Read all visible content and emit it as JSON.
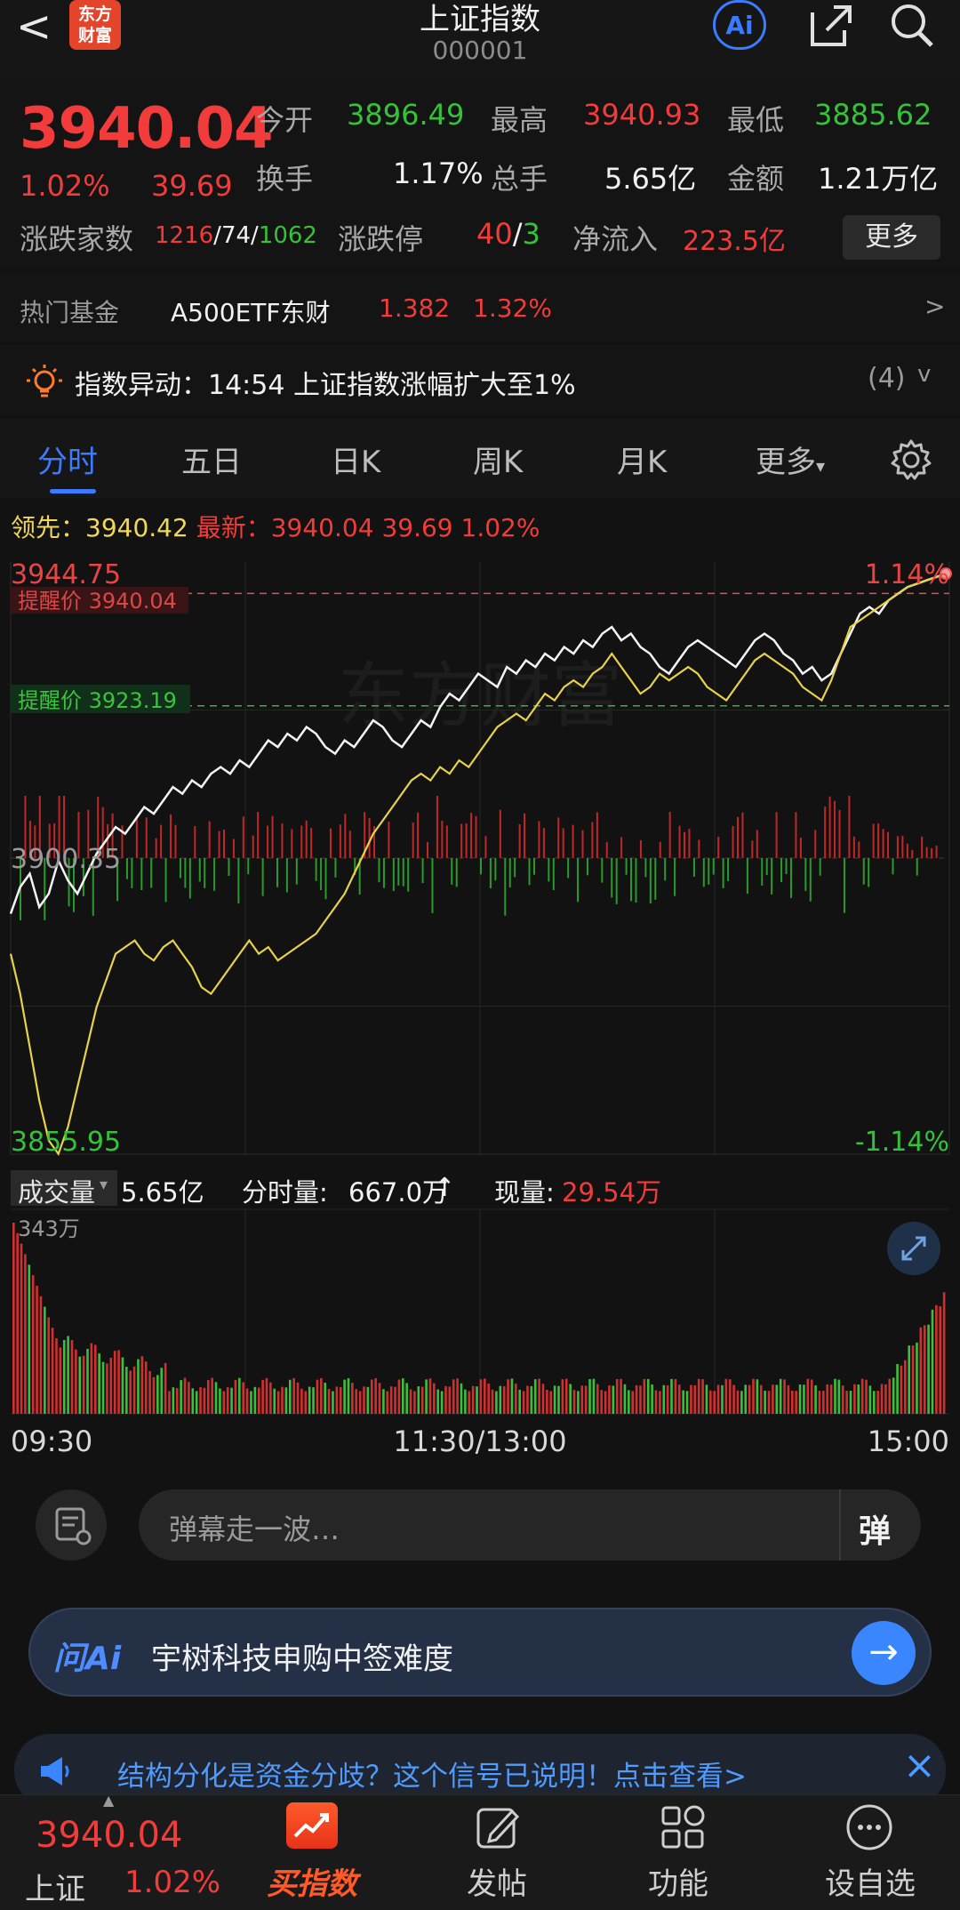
{
  "header": {
    "back": "<",
    "logo_line1": "东方",
    "logo_line2": "财富",
    "title": "上证指数",
    "code": "000001",
    "ai_label": "Ai",
    "icons": [
      "share-icon",
      "search-icon"
    ]
  },
  "quote": {
    "price": "3940.04",
    "pct": "1.02%",
    "change": "39.69",
    "open_label": "今开",
    "open": "3896.49",
    "high_label": "最高",
    "high": "3940.93",
    "low_label": "最低",
    "low": "3885.62",
    "turnover_label": "换手",
    "turnover": "1.17%",
    "vol_label": "总手",
    "vol": "5.65亿",
    "amount_label": "金额",
    "amount": "1.21万亿",
    "breadth_label": "涨跌家数",
    "up": "1216",
    "flat": "74",
    "down": "1062",
    "limit_label": "涨跌停",
    "limit_up": "40",
    "limit_down": "3",
    "inflow_label": "净流入",
    "inflow": "223.5亿",
    "more_label": "更多",
    "slash": "/"
  },
  "fund": {
    "label": "热门基金",
    "name": "A500ETF东财",
    "price": "1.382",
    "pct": "1.32%",
    "arrow": ">"
  },
  "alert": {
    "text": "指数异动：14:54 上证指数涨幅扩大至1%",
    "count": "(4)",
    "chevron": "v"
  },
  "tabs": [
    "分时",
    "五日",
    "日K",
    "周K",
    "月K",
    "更多"
  ],
  "leadline": {
    "lead_label": "领先：",
    "lead": "3940.42",
    "latest_label": "最新：",
    "latest": "3940.04",
    "chg": "39.69",
    "pct": "1.02%"
  },
  "chart_data": {
    "type": "line",
    "y_max_label": "3944.75",
    "y_min_label": "3855.95",
    "y_mid_label": "3900.35",
    "pct_max_label": "1.14%",
    "pct_min_label": "-1.14%",
    "ylim": [
      3855.95,
      3944.75
    ],
    "reminder_high_label": "提醒价 3940.04",
    "reminder_low_label": "提醒价 3923.19",
    "reminder_high": 3940.04,
    "reminder_low": 3923.19,
    "watermark": "东方财富",
    "series": [
      {
        "values": [
          3892,
          3896,
          3898,
          3893,
          3895,
          3900,
          3897,
          3895,
          3898,
          3901,
          3903,
          3905,
          3904,
          3906,
          3908,
          3907,
          3909,
          3911,
          3910,
          3912,
          3911,
          3913,
          3914,
          3913,
          3915,
          3914,
          3916,
          3918,
          3917,
          3919,
          3918,
          3920,
          3919,
          3917,
          3916,
          3918,
          3917,
          3919,
          3921,
          3920,
          3918,
          3917,
          3919,
          3921,
          3920,
          3923,
          3925,
          3924,
          3926,
          3928,
          3927,
          3926,
          3929,
          3928,
          3930,
          3929,
          3931,
          3930,
          3932,
          3931,
          3933,
          3932,
          3934,
          3935,
          3933,
          3934,
          3932,
          3931,
          3929,
          3928,
          3930,
          3932,
          3933,
          3932,
          3931,
          3930,
          3929,
          3931,
          3933,
          3934,
          3933,
          3931,
          3930,
          3928,
          3929,
          3927,
          3928,
          3931,
          3934,
          3937,
          3938,
          3937,
          3939,
          3940,
          3941,
          3941.5,
          3942,
          3942.5,
          3943
        ]
      },
      {
        "values": [
          3886,
          3880,
          3872,
          3864,
          3858,
          3856,
          3860,
          3866,
          3872,
          3878,
          3882,
          3886,
          3887,
          3888,
          3886,
          3885,
          3887,
          3888,
          3886,
          3884,
          3881,
          3880,
          3882,
          3884,
          3886,
          3888,
          3886,
          3887,
          3885,
          3886,
          3887,
          3888,
          3889,
          3891,
          3893,
          3895,
          3898,
          3901,
          3904,
          3906,
          3908,
          3910,
          3912,
          3913,
          3912,
          3914,
          3913,
          3915,
          3914,
          3916,
          3918,
          3920,
          3921,
          3922,
          3921,
          3923,
          3925,
          3924,
          3926,
          3927,
          3926,
          3928,
          3929,
          3931,
          3929,
          3927,
          3925,
          3926,
          3928,
          3927,
          3928,
          3929,
          3928,
          3926,
          3925,
          3924,
          3926,
          3928,
          3930,
          3931,
          3930,
          3929,
          3928,
          3926,
          3925,
          3924,
          3927,
          3931,
          3935,
          3936,
          3937,
          3938,
          3939,
          3940,
          3941,
          3941.5,
          3942,
          3942.5,
          3943
        ]
      }
    ]
  },
  "volume": {
    "label": "成交量",
    "total": "5.65亿",
    "tick_label": "分时量:",
    "tick": "667.0万",
    "tick_arrow": "↑",
    "now_label": "现量:",
    "now": "29.54万",
    "max_label": "343万",
    "time_start": "09:30",
    "time_mid": "11:30/13:00",
    "time_end": "15:00"
  },
  "comment": {
    "placeholder": "弹幕走一波…",
    "danmu": "弹"
  },
  "askai": {
    "logo": "问Ai",
    "text": "宇树科技申购中签难度",
    "arrow": "→"
  },
  "banner": {
    "text": "结构分化是资金分歧？这个信号已说明！点击查看>",
    "close": "×"
  },
  "bottom": {
    "price": "3940.04",
    "name": "上证",
    "pct": "1.02%",
    "buy": "买指数",
    "post": "发帖",
    "func": "功能",
    "watch": "设自选"
  }
}
